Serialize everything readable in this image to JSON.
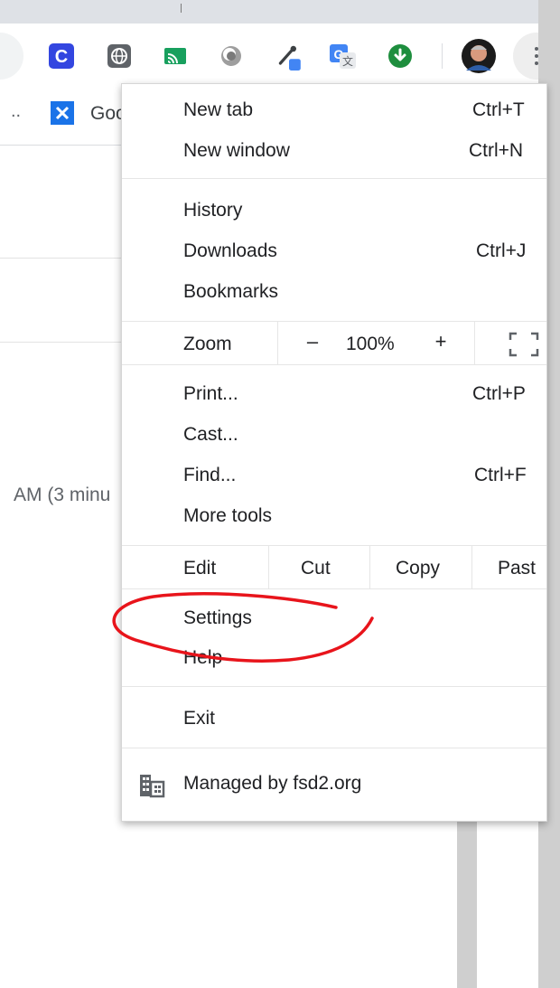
{
  "bookmarks_bar": {
    "overflow": "..",
    "item_label": "Goo",
    "item_icon": "x-square-icon"
  },
  "page": {
    "partial_text": "AM (3 minu"
  },
  "toolbar": {
    "extensions": [
      {
        "name": "c-extension-icon",
        "glyph": "C",
        "color": "#3346e0"
      },
      {
        "name": "globe-extension-icon",
        "glyph": "",
        "color": "#5f6368"
      },
      {
        "name": "cast-extension-icon",
        "glyph": "",
        "color": "#18a05e"
      },
      {
        "name": "circle-extension-icon",
        "glyph": "",
        "color": "#8a8a8a"
      },
      {
        "name": "eyedropper-extension-icon",
        "glyph": "",
        "color": "#3c4043"
      },
      {
        "name": "translate-extension-icon",
        "glyph": "G",
        "color": "#4285f4"
      },
      {
        "name": "download-extension-icon",
        "glyph": "",
        "color": "#1e8e3e"
      }
    ],
    "profile_icon": "avatar",
    "menu_icon": "kebab-menu-icon"
  },
  "menu": {
    "new_tab": {
      "label": "New tab",
      "shortcut": "Ctrl+T"
    },
    "new_window": {
      "label": "New window",
      "shortcut": "Ctrl+N"
    },
    "history": {
      "label": "History"
    },
    "downloads": {
      "label": "Downloads",
      "shortcut": "Ctrl+J"
    },
    "bookmarks": {
      "label": "Bookmarks"
    },
    "zoom": {
      "label": "Zoom",
      "minus": "–",
      "value": "100%",
      "plus": "+"
    },
    "print": {
      "label": "Print...",
      "shortcut": "Ctrl+P"
    },
    "cast": {
      "label": "Cast..."
    },
    "find": {
      "label": "Find...",
      "shortcut": "Ctrl+F"
    },
    "more_tools": {
      "label": "More tools"
    },
    "edit": {
      "label": "Edit",
      "cut": "Cut",
      "copy": "Copy",
      "paste": "Past"
    },
    "settings": {
      "label": "Settings"
    },
    "help": {
      "label": "Help"
    },
    "exit": {
      "label": "Exit"
    },
    "managed": {
      "label": "Managed by fsd2.org",
      "icon": "building-icon"
    }
  },
  "colors": {
    "annotation": "#e8141b",
    "menu_text": "#202124",
    "divider": "#e6e6e6"
  }
}
